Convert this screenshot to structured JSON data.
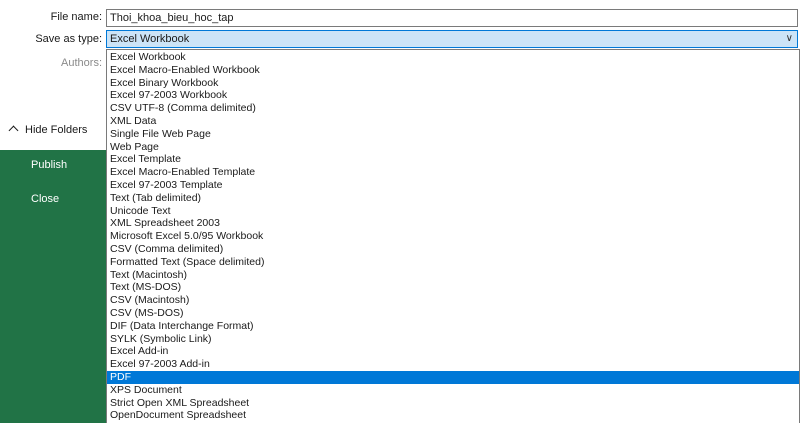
{
  "nav": {
    "publish": "Publish",
    "close": "Close"
  },
  "dialog": {
    "file_name_label": "File name:",
    "file_name_value": "Thoi_khoa_bieu_hoc_tap",
    "save_as_type_label": "Save as type:",
    "save_as_type_value": "Excel Workbook",
    "authors_label": "Authors:",
    "hide_folders_label": "Hide Folders"
  },
  "file_types": [
    "Excel Workbook",
    "Excel Macro-Enabled Workbook",
    "Excel Binary Workbook",
    "Excel 97-2003 Workbook",
    "CSV UTF-8 (Comma delimited)",
    "XML Data",
    "Single File Web Page",
    "Web Page",
    "Excel Template",
    "Excel Macro-Enabled Template",
    "Excel 97-2003 Template",
    "Text (Tab delimited)",
    "Unicode Text",
    "XML Spreadsheet 2003",
    "Microsoft Excel 5.0/95 Workbook",
    "CSV (Comma delimited)",
    "Formatted Text (Space delimited)",
    "Text (Macintosh)",
    "Text (MS-DOS)",
    "CSV (Macintosh)",
    "CSV (MS-DOS)",
    "DIF (Data Interchange Format)",
    "SYLK (Symbolic Link)",
    "Excel Add-in",
    "Excel 97-2003 Add-in",
    "PDF",
    "XPS Document",
    "Strict Open XML Spreadsheet",
    "OpenDocument Spreadsheet"
  ],
  "selected_type": "PDF",
  "colors": {
    "backstage": "#217346",
    "selection": "#0078d7",
    "field_highlight": "#cce4f7"
  }
}
